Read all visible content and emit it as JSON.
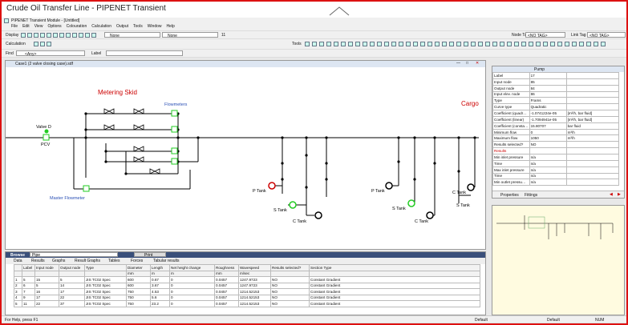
{
  "window": {
    "title": "Crude Oil Transfer Line - PIPENET Transient"
  },
  "app": {
    "module_title": "PIPENET Transient Module - [Untitled]",
    "menu": [
      "File",
      "Edit",
      "View",
      "Options",
      "Colouration",
      "Calculation",
      "Output",
      "Tools",
      "Window",
      "Help"
    ],
    "toolbar_rows": {
      "display": "Display",
      "calculation": "Calculation",
      "find": "Find"
    },
    "none1": "None",
    "none2": "None",
    "field_11": "11",
    "node_tag_label": "Node Tag",
    "node_tag_value": "<NO TAG>",
    "link_tag_label": "Link Tag",
    "link_tag_value": "<NO TAG>",
    "tools_label": "Tools",
    "find_value": "<Any>",
    "label_label": "Label"
  },
  "diagram": {
    "window_title": "Case1 (2 valve closing case).sdf",
    "labels": {
      "metering_skid": "Metering Skid",
      "flowmeters": "Flowmeters",
      "cargo": "Cargo",
      "valve_d": "Valve D",
      "pcv": "PCV",
      "master_flowmeter": "Master Flowmeter",
      "p_tank_1": "P Tank",
      "s_tank_1": "S Tank",
      "c_tank_1": "C Tank",
      "p_tank_2": "P Tank",
      "s_tank_2": "S Tank",
      "c_tank_2": "C Tank",
      "c_tank_3": "C Tank",
      "s_tank_3": "S Tank"
    }
  },
  "properties": {
    "header": "Pump",
    "rows": [
      {
        "k": "Label",
        "v": "17",
        "u": ""
      },
      {
        "k": "Input node",
        "v": "85",
        "u": ""
      },
      {
        "k": "Output node",
        "v": "84",
        "u": ""
      },
      {
        "k": "Input elev. node",
        "v": "86",
        "u": ""
      },
      {
        "k": "Type",
        "v": "Frams",
        "u": ""
      },
      {
        "k": "Curve type",
        "v": "Quadratic",
        "u": ""
      },
      {
        "k": "Coefficient (quadr…",
        "v": "-1.0741224e-05",
        "u": "[m³/h, bar fluid]"
      },
      {
        "k": "Coefficient (linear)",
        "v": "-1.7094941e-05",
        "u": "[m³/h, bar fluid]"
      },
      {
        "k": "Coefficient (consta…",
        "v": "15.80707",
        "u": "bar fluid"
      },
      {
        "k": "Minimum flow",
        "v": "0",
        "u": "m³/h"
      },
      {
        "k": "Maximum flow",
        "v": "1050",
        "u": "m³/h"
      },
      {
        "k": "Results selected?",
        "v": "NO",
        "u": ""
      },
      {
        "k": "Results",
        "v": "",
        "u": ""
      },
      {
        "k": "Min inlet pressure",
        "v": "n/a",
        "u": ""
      },
      {
        "k": "Time",
        "v": "n/a",
        "u": ""
      },
      {
        "k": "Max inlet pressure",
        "v": "n/a",
        "u": ""
      },
      {
        "k": "Time",
        "v": "n/a",
        "u": ""
      },
      {
        "k": "Min outlet pressu…",
        "v": "n/a",
        "u": ""
      }
    ],
    "tabs": [
      "Properties",
      "Fittings"
    ]
  },
  "browse": {
    "title": "Browse",
    "type_value": "Pipe",
    "print": "Print",
    "tabs": [
      "Data",
      "Results",
      "Graphs",
      "Result Graphs",
      "Tables",
      "Forces",
      "Tabular results"
    ],
    "columns": [
      "Label",
      "Input node",
      "Output node",
      "Type",
      "Diameter",
      "Length",
      "Net height change",
      "Roughness",
      "Wavespeed",
      "Results selected?",
      "Section Type"
    ],
    "units": [
      "",
      "",
      "",
      "",
      "mm",
      "m",
      "m",
      "mm",
      "m/sec",
      "",
      ""
    ],
    "rows": [
      [
        "1",
        "5",
        "15",
        "5",
        "JIS TC02 Spec",
        "600",
        "0.67",
        "0",
        "0.0457",
        "1247.9723",
        "NO",
        "Constant Gradient"
      ],
      [
        "2",
        "6",
        "5",
        "14",
        "JIS TC02 Spec",
        "600",
        "3.67",
        "0",
        "0.0457",
        "1247.9723",
        "NO",
        "Constant Gradient"
      ],
      [
        "3",
        "7",
        "16",
        "17",
        "JIS TC02 Spec",
        "750",
        "4.53",
        "0",
        "0.0457",
        "1214.52153",
        "NO",
        "Constant Gradient"
      ],
      [
        "4",
        "9",
        "17",
        "22",
        "JIS TC02 Spec",
        "750",
        "5.6",
        "0",
        "0.0457",
        "1214.52153",
        "NO",
        "Constant Gradient"
      ],
      [
        "5",
        "11",
        "22",
        "37",
        "JIS TC02 Spec",
        "750",
        "23.2",
        "0",
        "0.0457",
        "1214.52153",
        "NO",
        "Constant Gradient"
      ]
    ]
  },
  "status": {
    "help": "For Help, press F1",
    "default1": "Default",
    "default2": "Default",
    "num": "NUM"
  },
  "colors": {
    "accent": "#d11",
    "diagram_green": "#2c2",
    "metering_red": "#c00",
    "flowmeter_blue": "#2a4fb5"
  }
}
